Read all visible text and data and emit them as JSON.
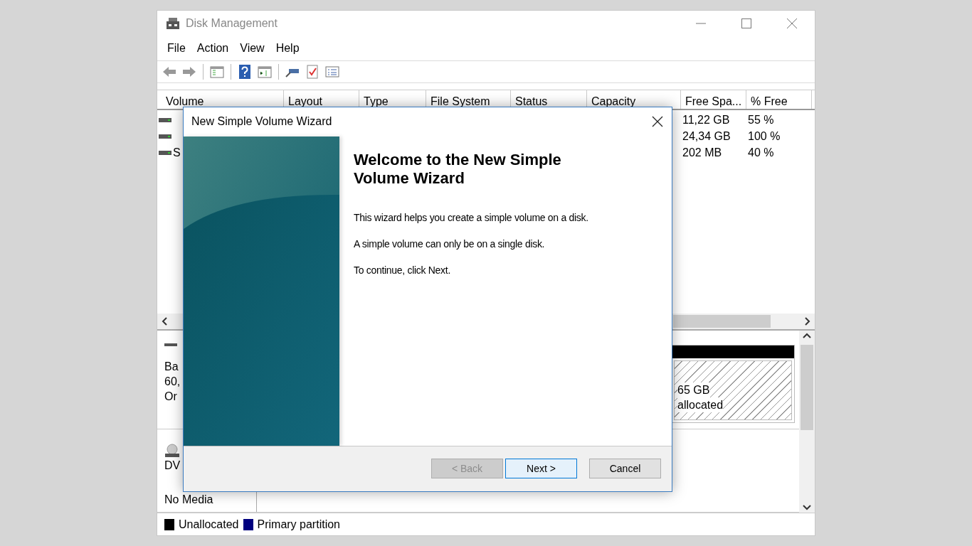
{
  "window": {
    "title": "Disk Management"
  },
  "menu": [
    "File",
    "Action",
    "View",
    "Help"
  ],
  "volume_table": {
    "columns": [
      "Volume",
      "Layout",
      "Type",
      "File System",
      "Status",
      "Capacity",
      "Free Spa...",
      "% Free"
    ],
    "rows": [
      {
        "free_space": "11,22 GB",
        "percent_free": "55 %"
      },
      {
        "free_space": "24,34 GB",
        "percent_free": "100 %"
      },
      {
        "volume": "S",
        "free_space": "202 MB",
        "percent_free": "40 %"
      }
    ]
  },
  "disks": [
    {
      "kind": "hdd",
      "lines": [
        "Ba",
        "60,",
        "Or"
      ],
      "partition": {
        "kind": "unallocated",
        "size": "65 GB",
        "status": "allocated"
      }
    },
    {
      "kind": "cdrom",
      "lines": [
        "DV"
      ],
      "status": "No Media"
    }
  ],
  "legend": [
    {
      "label": "Unallocated",
      "color": "#000000"
    },
    {
      "label": "Primary partition",
      "color": "#00007f"
    }
  ],
  "dialog": {
    "title": "New Simple Volume Wizard",
    "heading": "Welcome to the New Simple Volume Wizard",
    "paragraphs": [
      "This wizard helps you create a simple volume on a disk.",
      "A simple volume can only be on a single disk.",
      "To continue, click Next."
    ],
    "buttons": [
      {
        "label": "< Back",
        "disabled": true,
        "focused": false
      },
      {
        "label": "Next >",
        "disabled": false,
        "focused": true
      },
      {
        "label": "Cancel",
        "disabled": false,
        "focused": false
      }
    ]
  }
}
